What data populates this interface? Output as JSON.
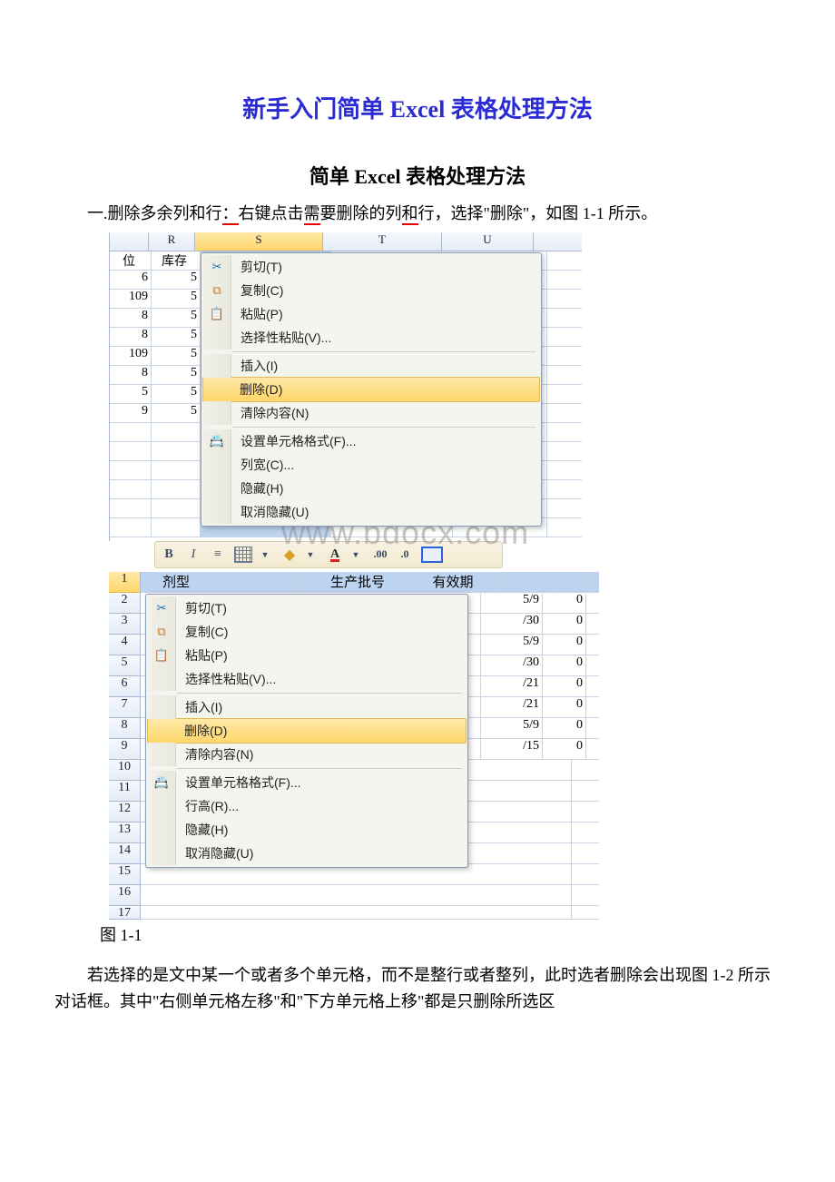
{
  "title": "新手入门简单 Excel 表格处理方法",
  "subtitle": "简单 Excel 表格处理方法",
  "para1_pre": "一.删除多余列和行",
  "para1_mid": "：",
  "para1_seg1": "右键点击",
  "para1_seg2": "需",
  "para1_seg3": "要删除的列",
  "para1_seg4": "和",
  "para1_seg5": "行，选择\"删除\"，如图 1-1 所示。",
  "watermark_text": "www.bdocx.com",
  "caption1": "图 1-1",
  "para2": "若选择的是文中某一个或者多个单元格，而不是整行或者整列，此时选者删除会出现图 1-2 所示对话框。其中\"右侧单元格左移\"和\"下方单元格上移\"都是只删除所选区",
  "sheet1": {
    "col_headers": [
      "",
      "R",
      "S",
      "T",
      "U"
    ],
    "left_header": [
      "位",
      "库存"
    ],
    "col1": [
      "6",
      "109",
      "8",
      "8",
      "109",
      "8",
      "5",
      "9"
    ],
    "col2": [
      "5",
      "5",
      "5",
      "5",
      "5",
      "5",
      "5",
      "5"
    ]
  },
  "context_menu": {
    "cut": "剪切(T)",
    "copy": "复制(C)",
    "paste": "粘贴(P)",
    "paste_special": "选择性粘贴(V)...",
    "insert": "插入(I)",
    "delete": "删除(D)",
    "clear": "清除内容(N)",
    "format": "设置单元格格式(F)...",
    "col_width": "列宽(C)...",
    "row_height": "行高(R)...",
    "hide": "隐藏(H)",
    "unhide": "取消隐藏(U)"
  },
  "sheet2": {
    "header_row": [
      "剂型",
      "",
      "生产批号",
      "有效期",
      ""
    ],
    "right_data": [
      [
        "5/9",
        "0"
      ],
      [
        "/30",
        "0"
      ],
      [
        "5/9",
        "0"
      ],
      [
        "/30",
        "0"
      ],
      [
        "/21",
        "0"
      ],
      [
        "/21",
        "0"
      ],
      [
        "5/9",
        "0"
      ],
      [
        "/15",
        "0"
      ]
    ]
  }
}
